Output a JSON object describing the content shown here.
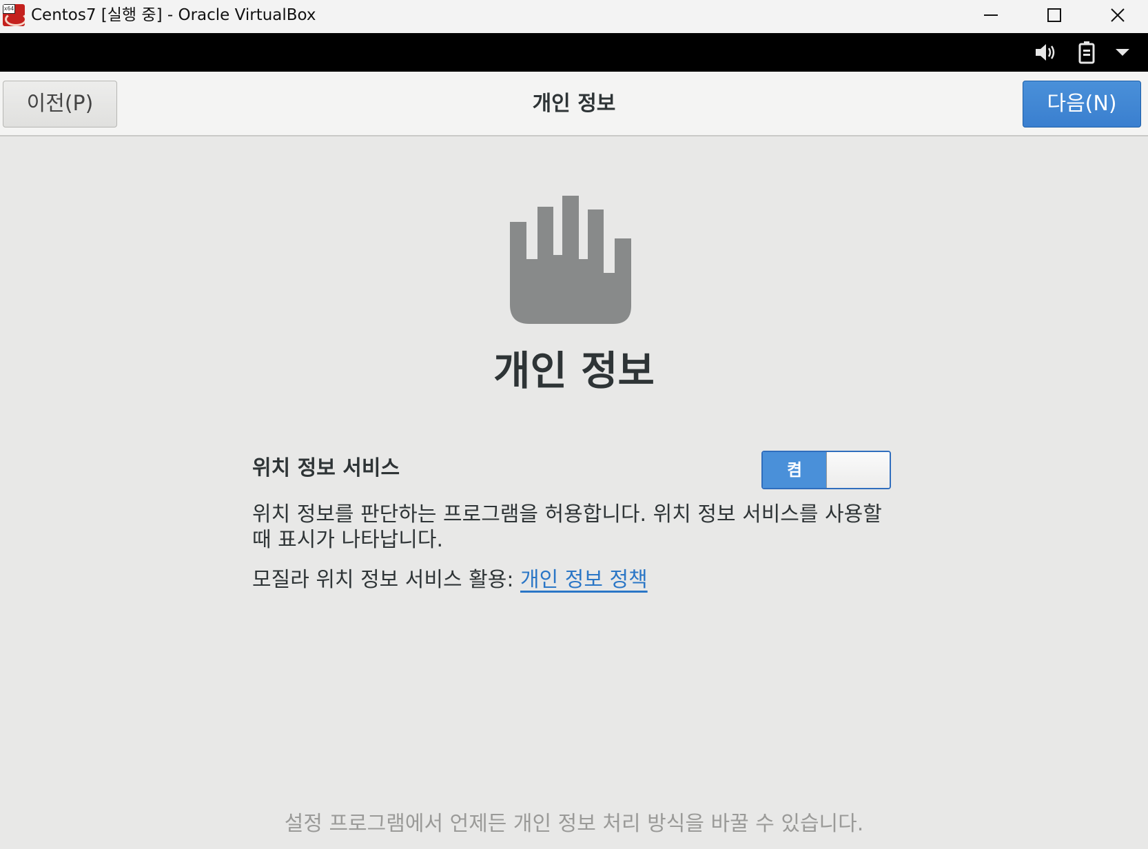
{
  "window": {
    "title": "Centos7 [실행 중] - Oracle VirtualBox",
    "app_icon_badge": "x64",
    "controls": [
      "minimize-icon",
      "maximize-icon",
      "close-icon"
    ]
  },
  "vm_toolbar": {
    "icons": [
      "speaker-icon",
      "battery-icon",
      "dropdown-arrow-icon"
    ]
  },
  "header": {
    "back_label": "이전(P)",
    "title": "개인 정보",
    "next_label": "다음(N)"
  },
  "main": {
    "icon": "privacy-hand-icon",
    "title": "개인 정보",
    "location_label": "위치 정보 서비스",
    "toggle_label": "켬",
    "toggle_state": "on",
    "description": "위치 정보를 판단하는 프로그램을 허용합니다. 위치 정보 서비스를 사용할 때 표시가 나타납니다.",
    "mozilla_prefix": "모질라 위치 정보 서비스 활용:",
    "privacy_link": "개인 정보 정책",
    "footer_note": "설정 프로그램에서 언제든 개인 정보 처리 방식을 바꿀 수 있습니다."
  },
  "colors": {
    "accent": "#4a90d9",
    "link": "#2a76c6",
    "background": "#e8e8e7",
    "icon_gray": "#888a8a"
  }
}
